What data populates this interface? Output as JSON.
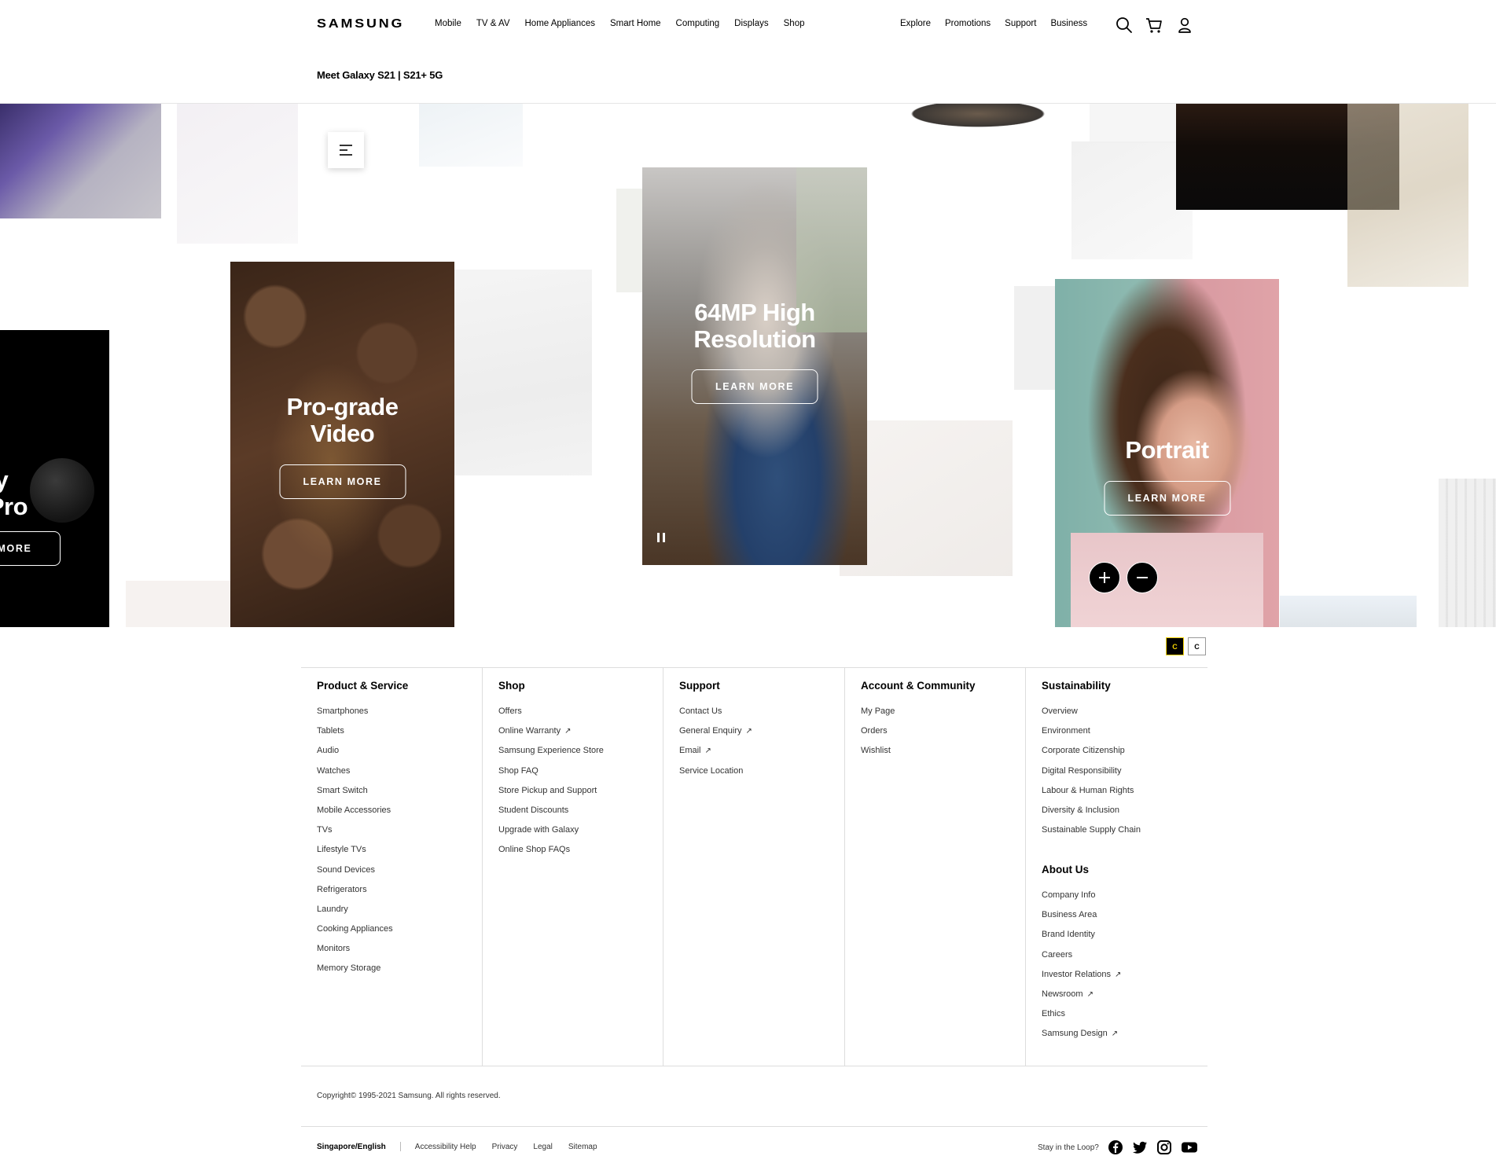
{
  "header": {
    "logo": "SAMSUNG",
    "nav_main": [
      "Mobile",
      "TV & AV",
      "Home Appliances",
      "Smart Home",
      "Computing",
      "Displays",
      "Shop"
    ],
    "nav_right": [
      "Explore",
      "Promotions",
      "Support",
      "Business"
    ],
    "icons": [
      "search-icon",
      "cart-icon",
      "user-icon"
    ],
    "subnav_title": "Meet Galaxy S21 | S21+ 5G"
  },
  "hero": {
    "cards": [
      {
        "title_line1": "axy",
        "title_line2": "s Pro",
        "button": "MORE"
      },
      {
        "title_line1": "Pro-grade",
        "title_line2": "Video",
        "button": "LEARN MORE"
      },
      {
        "title_line1": "64MP High",
        "title_line2": "Resolution",
        "button": "LEARN MORE"
      },
      {
        "title_line1": "Portrait",
        "title_line2": "",
        "button": "LEARN MORE"
      }
    ],
    "controls": {
      "menu_icon": "menu-icon",
      "pause_icon": "pause-icon",
      "zoom_in_icon": "plus-icon",
      "zoom_out_icon": "minus-icon"
    },
    "contrast_labels": [
      "C",
      "C"
    ]
  },
  "footer": {
    "columns": [
      {
        "heading": "Product & Service",
        "links": [
          "Smartphones",
          "Tablets",
          "Audio",
          "Watches",
          "Smart Switch",
          "Mobile Accessories",
          "TVs",
          "Lifestyle TVs",
          "Sound Devices",
          "Refrigerators",
          "Laundry",
          "Cooking Appliances",
          "Monitors",
          "Memory Storage"
        ]
      },
      {
        "heading": "Shop",
        "links": [
          "Offers",
          "Online Warranty",
          "Samsung Experience Store",
          "Shop FAQ",
          "Store Pickup and Support",
          "Student Discounts",
          "Upgrade with Galaxy",
          "Online Shop FAQs"
        ]
      },
      {
        "heading": "Support",
        "links": [
          "Contact Us",
          "General Enquiry",
          "Email",
          "Service Location"
        ]
      },
      {
        "heading": "Account & Community",
        "links": [
          "My Page",
          "Orders",
          "Wishlist"
        ]
      },
      {
        "heading": "Sustainability",
        "links": [
          "Overview",
          "Environment",
          "Corporate Citizenship",
          "Digital Responsibility",
          "Labour & Human Rights",
          "Diversity & Inclusion",
          "Sustainable Supply Chain"
        ],
        "heading2": "About Us",
        "links2": [
          "Company Info",
          "Business Area",
          "Brand Identity",
          "Careers",
          "Investor Relations",
          "Newsroom",
          "Ethics",
          "Samsung Design"
        ]
      }
    ],
    "copyright": "Copyright© 1995-2021 Samsung. All rights reserved.",
    "region": "Singapore/English",
    "bottom_links": [
      "Accessibility Help",
      "Privacy",
      "Legal",
      "Sitemap"
    ],
    "social_label": "Stay in the Loop?",
    "social_icons": [
      "facebook-icon",
      "twitter-icon",
      "instagram-icon",
      "youtube-icon"
    ]
  }
}
